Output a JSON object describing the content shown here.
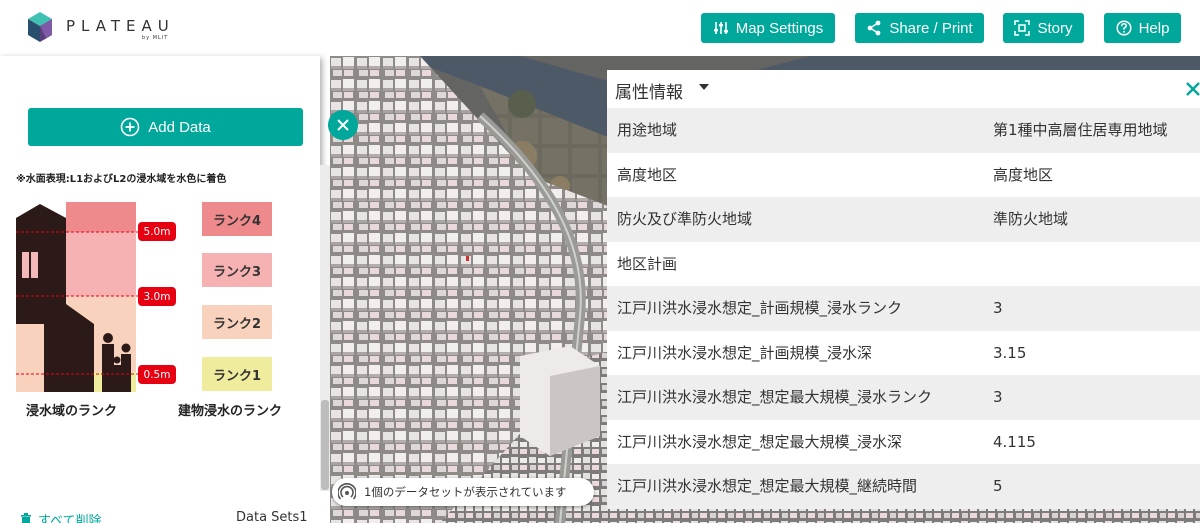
{
  "header": {
    "logo_text": "PLATEAU",
    "logo_sub": "by MLIT",
    "buttons": [
      {
        "label": "Map Settings",
        "icon": "sliders-icon"
      },
      {
        "label": "Share / Print",
        "icon": "share-icon"
      },
      {
        "label": "Story",
        "icon": "story-icon"
      },
      {
        "label": "Help",
        "icon": "help-icon"
      }
    ],
    "accent": "#00a89c"
  },
  "sidebar": {
    "add_data_label": "Add Data",
    "legend": {
      "note": "※水面表現:L1およびL2の浸水域を水色に着色",
      "depths": [
        "5.0m",
        "3.0m",
        "0.5m"
      ],
      "ranks": [
        {
          "label": "ランク4",
          "color": "#ee8a8c"
        },
        {
          "label": "ランク3",
          "color": "#f6b2b2"
        },
        {
          "label": "ランク2",
          "color": "#f9d2bd"
        },
        {
          "label": "ランク1",
          "color": "#efec9e"
        }
      ],
      "caption_area": "浸水域のランク",
      "caption_building": "建物浸水のランク"
    },
    "clear_all_label": "すべて削除",
    "datasets_label": "Data Sets1"
  },
  "map": {
    "status_text": "1個のデータセットが表示されています"
  },
  "info_panel": {
    "title": "属性情報",
    "rows": [
      {
        "key": "用途地域",
        "value": "第1種中高層住居専用地域"
      },
      {
        "key": "高度地区",
        "value": "高度地区"
      },
      {
        "key": "防火及び準防火地域",
        "value": "準防火地域"
      },
      {
        "key": "地区計画",
        "value": ""
      },
      {
        "key": "江戸川洪水浸水想定_計画規模_浸水ランク",
        "value": "3"
      },
      {
        "key": "江戸川洪水浸水想定_計画規模_浸水深",
        "value": "3.15"
      },
      {
        "key": "江戸川洪水浸水想定_想定最大規模_浸水ランク",
        "value": "3"
      },
      {
        "key": "江戸川洪水浸水想定_想定最大規模_浸水深",
        "value": "4.115"
      },
      {
        "key": "江戸川洪水浸水想定_想定最大規模_継続時間",
        "value": "5"
      }
    ]
  }
}
